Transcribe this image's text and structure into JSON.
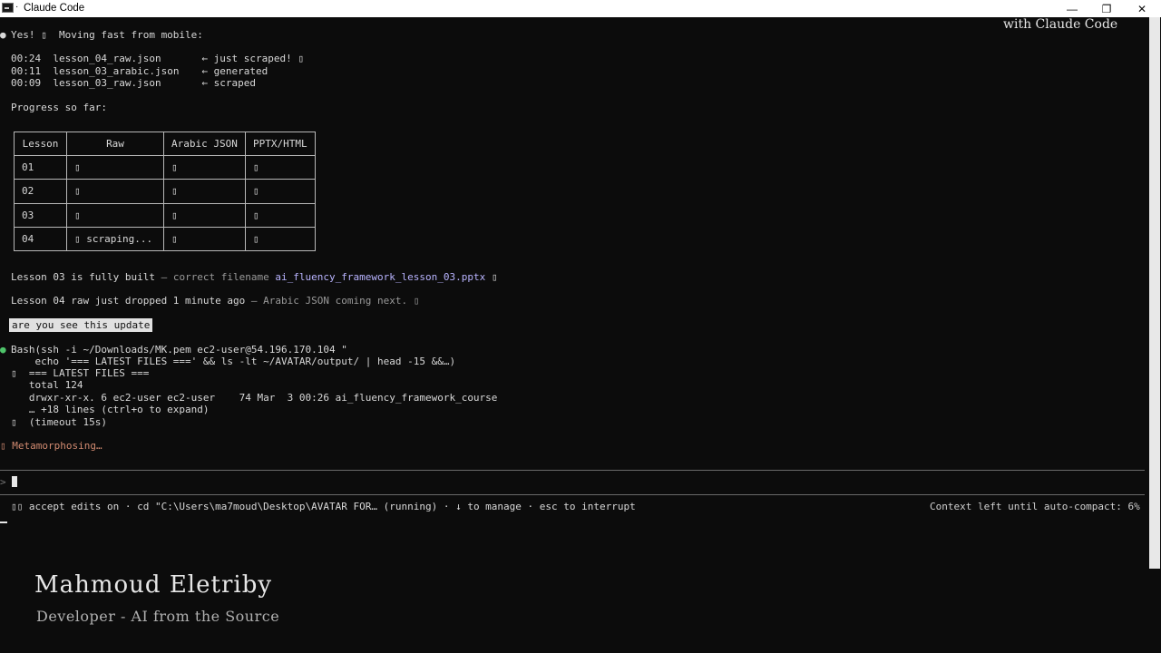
{
  "window": {
    "title": "Claude Code",
    "minimize": "—",
    "maximize": "❐",
    "close": "✕"
  },
  "corner_note": "with Claude Code",
  "assistant": {
    "bullet": "●",
    "message": "Yes! ▯  Moving fast from mobile:",
    "files": [
      {
        "time": "00:24",
        "name": "lesson_04_raw.json",
        "status": "← just scraped! ▯"
      },
      {
        "time": "00:11",
        "name": "lesson_03_arabic.json",
        "status": "← generated"
      },
      {
        "time": "00:09",
        "name": "lesson_03_raw.json",
        "status": "← scraped"
      }
    ],
    "progress_label": "Progress so far:",
    "table": {
      "headers": [
        "Lesson",
        "Raw",
        "Arabic JSON",
        "PPTX/HTML"
      ],
      "rows": [
        [
          "01",
          "▯",
          "▯",
          "▯"
        ],
        [
          "02",
          "▯",
          "▯",
          "▯"
        ],
        [
          "03",
          "▯",
          "▯",
          "▯"
        ],
        [
          "04",
          "▯ scraping...",
          "▯",
          "▯"
        ]
      ]
    },
    "built_line": {
      "lead": "Lesson 03 is fully built",
      "middle": " — correct filename ",
      "filename": "ai_fluency_framework_lesson_03.pptx",
      "tail": " ▯"
    },
    "raw_line": {
      "lead": "Lesson 04 raw just dropped 1 minute ago",
      "tail": " — Arabic JSON coming next. ▯"
    }
  },
  "user_message": "are you see this update",
  "tool": {
    "bullet": "●",
    "name": "Bash",
    "command_1": "(ssh -i ~/Downloads/MK.pem ec2-user@54.196.170.104 \"",
    "command_2": "    echo '=== LATEST FILES ===' && ls -lt ~/AVATAR/output/ | head -15 &&…)",
    "output_1": "▯  === LATEST FILES ===",
    "output_2": "   total 124",
    "output_3": "   drwxr-xr-x. 6 ec2-user ec2-user    74 Mar  3 00:26 ai_fluency_framework_course",
    "output_4": "   … +18 lines (ctrl+o to expand)",
    "output_5": "▯  (timeout 15s)"
  },
  "spinner": {
    "glyph": "▯",
    "text": " Metamorphosing…"
  },
  "prompt_symbol": ">",
  "status_bar": {
    "left_icon": "▯▯",
    "left_text": " accept edits on · cd \"C:\\Users\\ma7moud\\Desktop\\AVATAR FOR… (running) · ↓ to manage · esc to interrupt",
    "right_text": "Context left until auto-compact: 6%"
  },
  "signature": {
    "name": "Mahmoud Eletriby",
    "subtitle": "Developer - AI from the Source"
  }
}
